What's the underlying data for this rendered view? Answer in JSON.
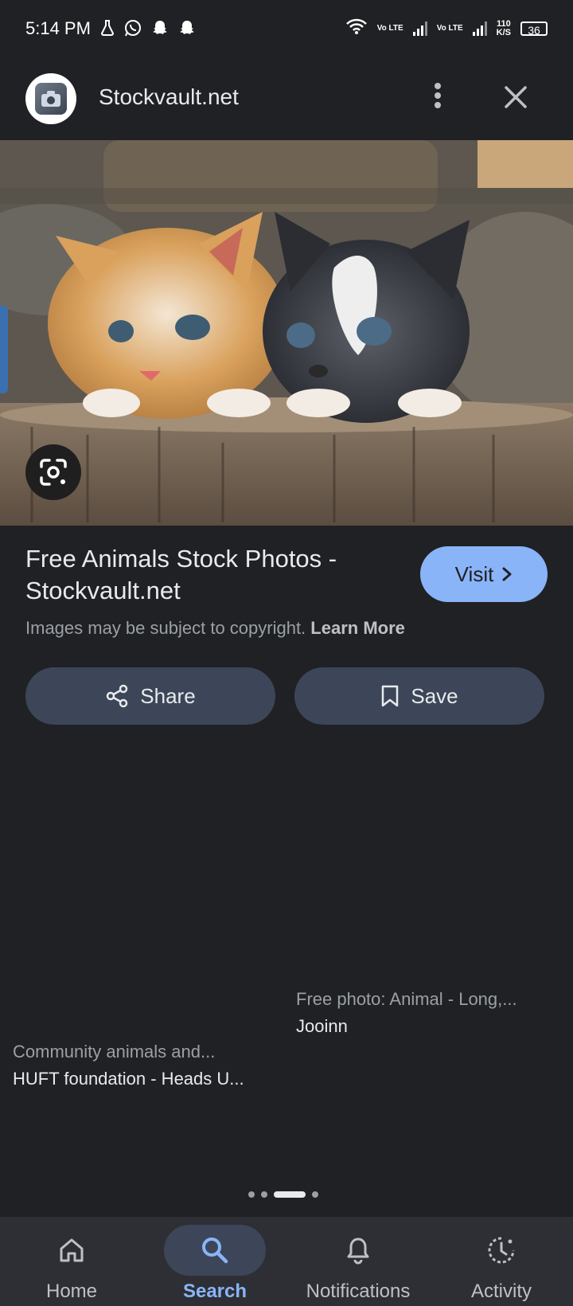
{
  "status_bar": {
    "time": "5:14 PM",
    "left_icons": [
      "lab-flask-icon",
      "whatsapp-icon",
      "snapchat-icon",
      "snapchat-icon"
    ],
    "volte1": "Vo LTE",
    "volte2": "Vo LTE",
    "speed_value": "110",
    "speed_unit": "K/S",
    "battery": "36"
  },
  "header": {
    "site_name": "Stockvault.net"
  },
  "result": {
    "title": "Free Animals Stock Photos - Stockvault.net",
    "visit_label": "Visit",
    "copyright_text": "Images may be subject to copyright.",
    "learn_more": "Learn More",
    "share_label": "Share",
    "save_label": "Save"
  },
  "related": [
    {
      "title": "Community animals and...",
      "source": "HUFT foundation - Heads U..."
    },
    {
      "title": "Free photo: Animal - Long,...",
      "source": "Jooinn"
    }
  ],
  "pager": {
    "count": 4,
    "active_index": 2
  },
  "nav": {
    "items": [
      {
        "label": "Home",
        "icon": "home-icon"
      },
      {
        "label": "Search",
        "icon": "search-icon",
        "active": true
      },
      {
        "label": "Notifications",
        "icon": "bell-icon"
      },
      {
        "label": "Activity",
        "icon": "activity-icon"
      }
    ]
  },
  "colors": {
    "background": "#202124",
    "accent": "#8ab4f8",
    "button_bg": "#3c4658",
    "nav_bg": "#2d2f34"
  }
}
